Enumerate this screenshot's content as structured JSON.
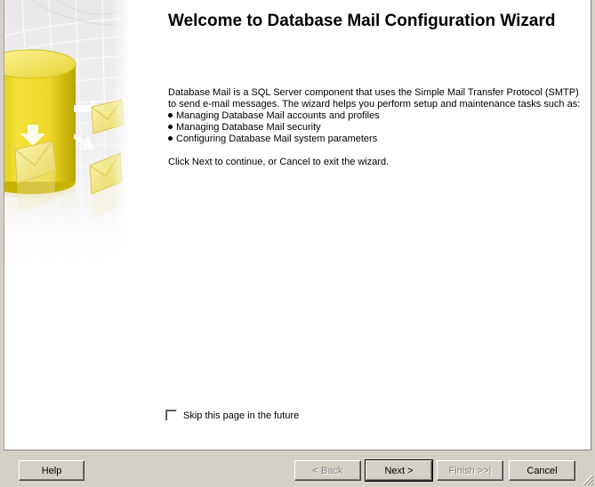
{
  "wizard": {
    "title": "Welcome to Database Mail Configuration Wizard",
    "intro": "Database Mail is a SQL Server component that uses the Simple Mail Transfer Protocol (SMTP) to send e-mail messages. The wizard helps you perform setup and maintenance tasks such as:",
    "bullets": [
      "Managing Database Mail accounts and profiles",
      "Managing Database Mail security",
      "Configuring Database Mail system parameters"
    ],
    "instruction": "Click Next to continue, or Cancel to exit the wizard.",
    "skip_label": "Skip this page in the future",
    "skip_checked": false
  },
  "buttons": {
    "help": "Help",
    "back": "< Back",
    "next": "Next >",
    "finish": "Finish >>|",
    "cancel": "Cancel"
  },
  "icons": {
    "banner": "database-mail-icon",
    "grip": "resize-grip-icon"
  },
  "colors": {
    "dialog_bg": "#d4d0c8",
    "content_bg": "#ffffff",
    "cylinder": "#f2dc3a",
    "envelope": "#f5e98c",
    "disabled_text": "#808080"
  }
}
